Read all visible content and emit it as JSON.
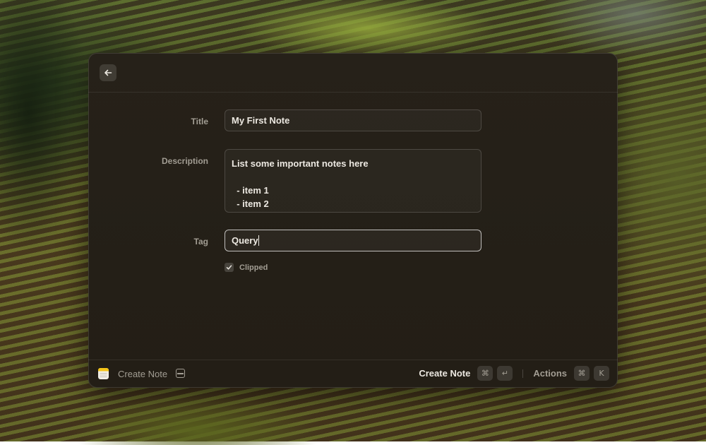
{
  "form": {
    "title_label": "Title",
    "title_value": "My First Note",
    "description_label": "Description",
    "description_value": "List some important notes here\n\n  - item 1\n  - item 2",
    "tag_label": "Tag",
    "tag_value": "Query",
    "clipped_label": "Clipped",
    "clipped_checked": true
  },
  "footer": {
    "command_title": "Create Note",
    "primary_action": "Create Note",
    "primary_shortcut": [
      "⌘",
      "↵"
    ],
    "secondary_action": "Actions",
    "secondary_shortcut": [
      "⌘",
      "K"
    ]
  },
  "icons": {
    "back": "arrow-left-icon",
    "note": "notes-app-icon",
    "toggle": "window-toggle-icon",
    "check": "checkmark-icon"
  }
}
